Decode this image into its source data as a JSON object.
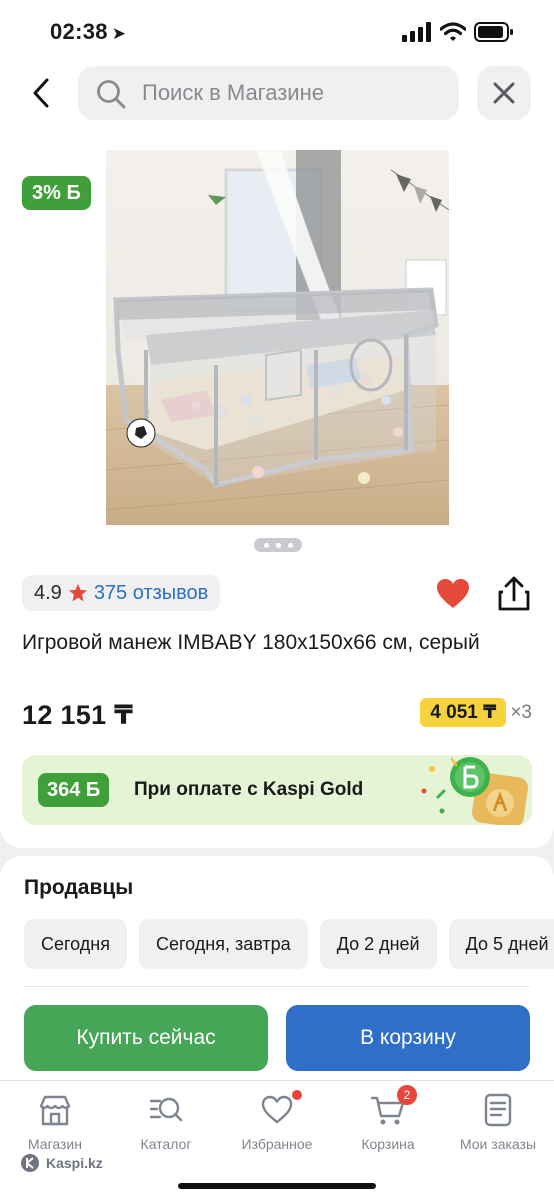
{
  "status_bar": {
    "time": "02:38"
  },
  "search": {
    "placeholder": "Поиск в Магазине"
  },
  "product": {
    "cashback_badge": "3% Б",
    "rating": "4.9",
    "reviews": "375 отзывов",
    "title": "Игровой манеж IMBABY 180x150x66 см, серый",
    "price": "12 151 ₸",
    "installment_amount": "4 051 ₸",
    "installment_multiplier": "×3"
  },
  "kaspi_gold": {
    "bonus": "364 Б",
    "text": "При оплате с Kaspi Gold"
  },
  "sellers": {
    "title": "Продавцы",
    "filters": [
      "Сегодня",
      "Сегодня, завтра",
      "До 2 дней",
      "До 5 дней"
    ]
  },
  "actions": {
    "buy_now": "Купить сейчас",
    "add_to_cart": "В корзину"
  },
  "tab_bar": {
    "items": [
      {
        "label": "Магазин",
        "icon": "store-icon"
      },
      {
        "label": "Каталог",
        "icon": "catalog-search-icon"
      },
      {
        "label": "Избранное",
        "icon": "heart-icon"
      },
      {
        "label": "Корзина",
        "icon": "cart-icon",
        "badge": "2"
      },
      {
        "label": "Мои заказы",
        "icon": "orders-icon"
      }
    ]
  },
  "watermark": "Kaspi.kz",
  "colors": {
    "green": "#3f9f39",
    "blue": "#2f6fca",
    "yellow": "#f6d33c",
    "red": "#e8453c",
    "link": "#2b6fc2"
  }
}
